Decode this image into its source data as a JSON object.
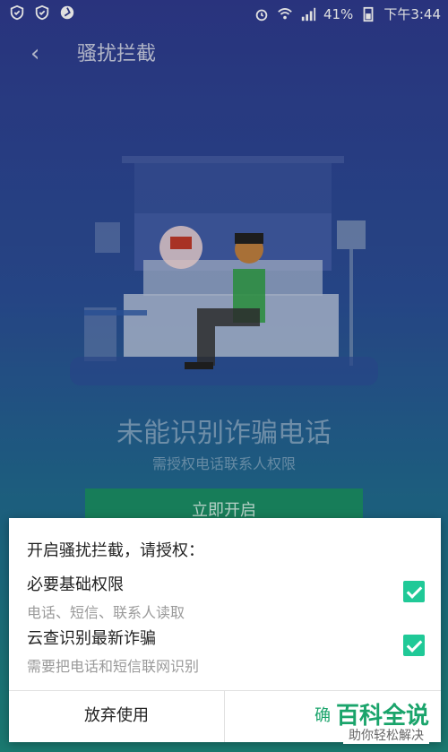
{
  "status_bar": {
    "battery": "41%",
    "time": "下午3:44",
    "left_icons": [
      "shield-check-icon",
      "shield-check-icon",
      "aperture-icon"
    ],
    "right_icons": [
      "alarm-icon",
      "wifi-icon",
      "signal-icon",
      "battery-icon"
    ]
  },
  "header": {
    "back_icon": "chevron-left-icon",
    "title": "骚扰拦截"
  },
  "background_screen": {
    "headline": "未能识别诈骗电话",
    "subline": "需授权电话联系人权限",
    "enable_button": "立即开启"
  },
  "dialog": {
    "title": "开启骚扰拦截，请授权：",
    "permissions": [
      {
        "title": "必要基础权限",
        "desc": "电话、短信、联系人读取",
        "checked": true
      },
      {
        "title": "云查识别最新诈骗",
        "desc": "需要把电话和短信联网识别",
        "checked": true
      }
    ],
    "cancel_label": "放弃使用",
    "confirm_label": "确",
    "accent": "#20c997"
  },
  "watermark": {
    "big": "百科全说",
    "small": "助你轻松解决"
  }
}
